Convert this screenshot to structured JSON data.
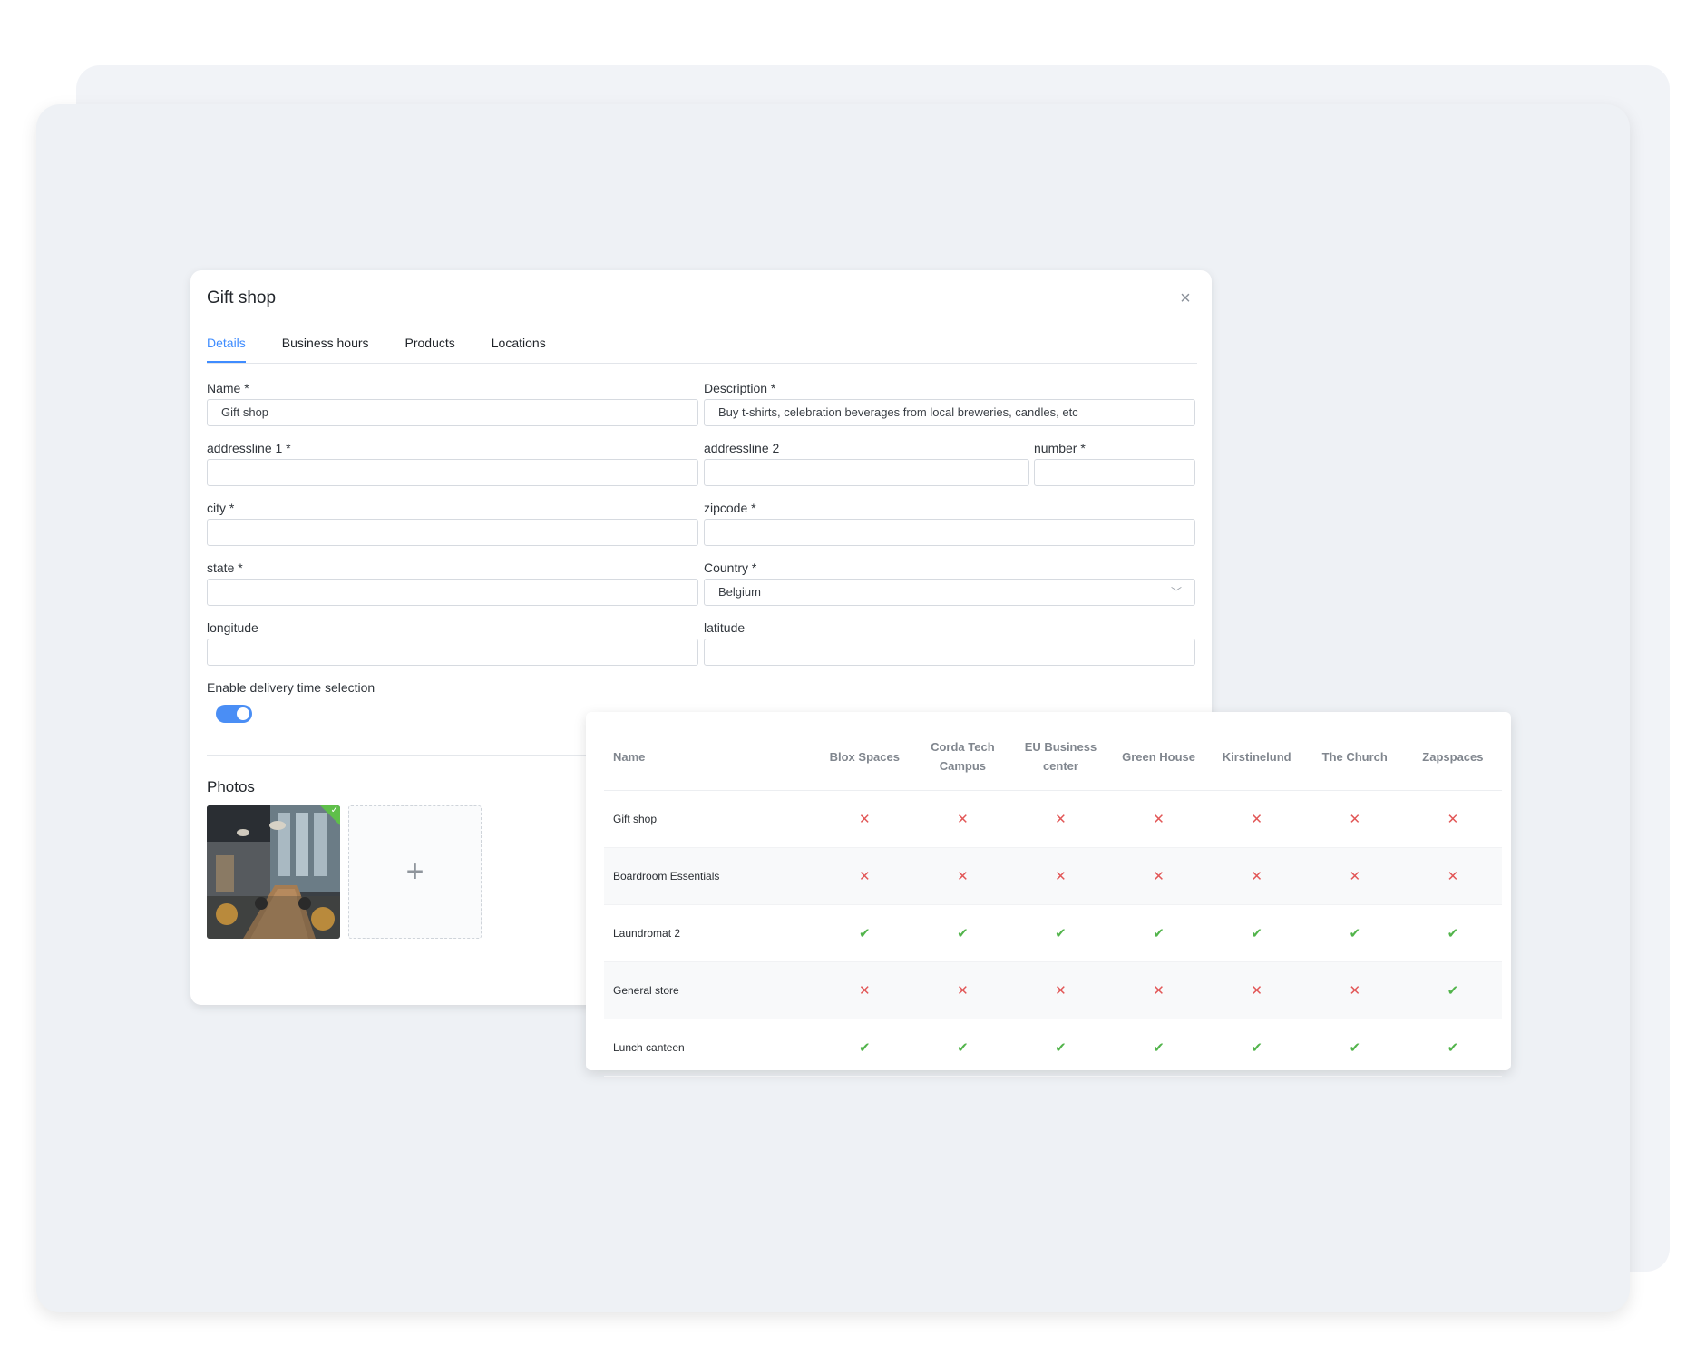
{
  "modal": {
    "title": "Gift shop",
    "close_icon": "close-icon",
    "tabs": [
      {
        "label": "Details",
        "active": true
      },
      {
        "label": "Business hours",
        "active": false
      },
      {
        "label": "Products",
        "active": false
      },
      {
        "label": "Locations",
        "active": false
      }
    ],
    "fields": {
      "name": {
        "label": "Name *",
        "value": "Gift shop"
      },
      "description": {
        "label": "Description *",
        "value": "Buy t-shirts, celebration beverages from local breweries, candles, etc"
      },
      "addressline1": {
        "label": "addressline 1 *",
        "value": ""
      },
      "addressline2": {
        "label": "addressline 2",
        "value": ""
      },
      "number": {
        "label": "number *",
        "value": ""
      },
      "city": {
        "label": "city *",
        "value": ""
      },
      "zipcode": {
        "label": "zipcode *",
        "value": ""
      },
      "state": {
        "label": "state *",
        "value": ""
      },
      "country": {
        "label": "Country *",
        "value": "Belgium"
      },
      "longitude": {
        "label": "longitude",
        "value": ""
      },
      "latitude": {
        "label": "latitude",
        "value": ""
      }
    },
    "delivery_toggle": {
      "label": "Enable delivery time selection",
      "on": true,
      "color": "#4a8ef5"
    },
    "photos": {
      "title": "Photos",
      "add_icon": "plus-icon"
    }
  },
  "locations_table": {
    "columns": [
      "Name",
      "Blox Spaces",
      "Corda Tech Campus",
      "EU Business center",
      "Green House",
      "Kirstinelund",
      "The Church",
      "Zapspaces"
    ],
    "rows": [
      {
        "name": "Gift shop",
        "values": [
          "✕",
          "✕",
          "✕",
          "✕",
          "✕",
          "✕",
          "✕"
        ]
      },
      {
        "name": "Boardroom Essentials",
        "values": [
          "✕",
          "✕",
          "✕",
          "✕",
          "✕",
          "✕",
          "✕"
        ]
      },
      {
        "name": "Laundromat 2",
        "values": [
          "✔",
          "✔",
          "✔",
          "✔",
          "✔",
          "✔",
          "✔"
        ]
      },
      {
        "name": "General store",
        "values": [
          "✕",
          "✕",
          "✕",
          "✕",
          "✕",
          "✕",
          "✔"
        ]
      },
      {
        "name": "Lunch canteen",
        "values": [
          "✔",
          "✔",
          "✔",
          "✔",
          "✔",
          "✔",
          "✔"
        ]
      }
    ],
    "colors": {
      "available": "#52b44b",
      "unavailable": "#e25757",
      "accent": "#3f8cff"
    }
  }
}
